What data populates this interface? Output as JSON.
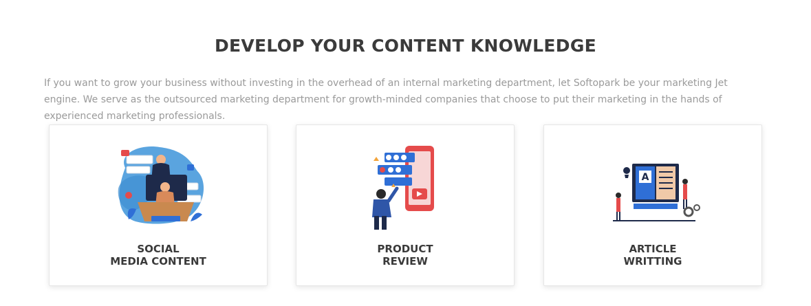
{
  "section": {
    "title": "DEVELOP YOUR CONTENT KNOWLEDGE",
    "description": "If you want to grow your business without investing in the overhead of an internal marketing department, let Softopark be your marketing Jet engine. We serve as the outsourced marketing department for growth-minded companies that choose to put their marketing in the hands of experienced marketing professionals."
  },
  "cards": [
    {
      "line1": "SOCIAL",
      "line2": "MEDIA CONTENT",
      "icon": "social-media-illustration-icon"
    },
    {
      "line1": "PRODUCT",
      "line2": "REVIEW",
      "icon": "product-review-illustration-icon"
    },
    {
      "line1": "ARTICLE",
      "line2": "WRITTING",
      "icon": "article-writing-illustration-icon"
    }
  ],
  "colors": {
    "accent_blue": "#2f6fd6",
    "accent_red": "#e54b4b",
    "dark_navy": "#1e2a4a"
  }
}
